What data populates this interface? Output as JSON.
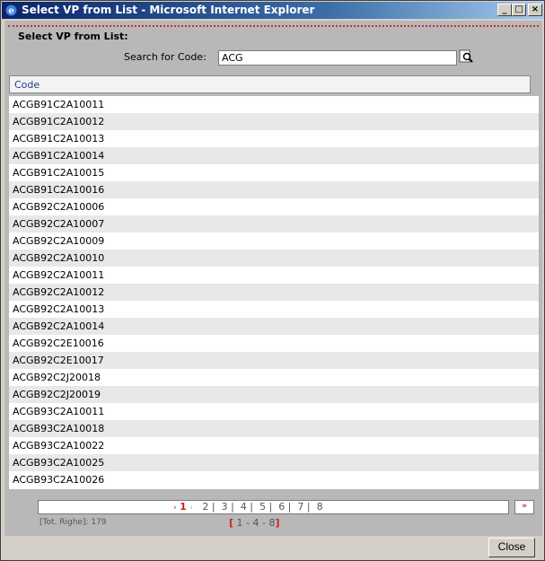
{
  "window": {
    "title": "Select VP from List - Microsoft Internet Explorer"
  },
  "header": {
    "title": "Select VP from List:"
  },
  "search": {
    "label": "Search for Code:",
    "value": "ACG"
  },
  "table": {
    "column": "Code",
    "rows": [
      "ACGB91C2A10011",
      "ACGB91C2A10012",
      "ACGB91C2A10013",
      "ACGB91C2A10014",
      "ACGB91C2A10015",
      "ACGB91C2A10016",
      "ACGB92C2A10006",
      "ACGB92C2A10007",
      "ACGB92C2A10009",
      "ACGB92C2A10010",
      "ACGB92C2A10011",
      "ACGB92C2A10012",
      "ACGB92C2A10013",
      "ACGB92C2A10014",
      "ACGB92C2E10016",
      "ACGB92C2E10017",
      "ACGB92C2J20018",
      "ACGB92C2J20019",
      "ACGB93C2A10011",
      "ACGB93C2A10018",
      "ACGB93C2A10022",
      "ACGB93C2A10025",
      "ACGB93C2A10026"
    ]
  },
  "pager": {
    "current": "1",
    "pages": [
      "2",
      "3",
      "4",
      "5",
      "6",
      "7",
      "8"
    ],
    "total": "[Tot. Righe]: 179",
    "range_open": "[",
    "range": " 1 - 4 - 8",
    "range_close": "]",
    "prev_arrow": "›",
    "prev2_arrow": "‹",
    "next": "»"
  },
  "buttons": {
    "close": "Close"
  },
  "colors": {
    "accent": "#d01c1c",
    "titlebar": "#0a246a"
  }
}
